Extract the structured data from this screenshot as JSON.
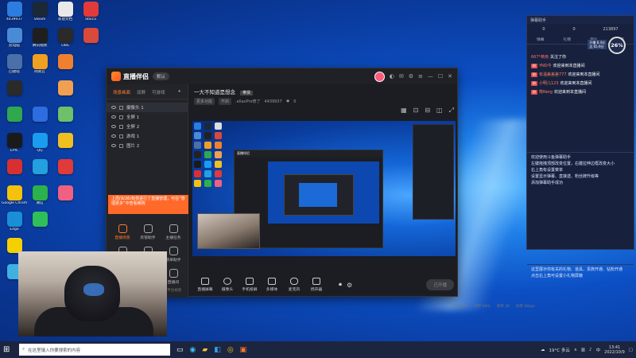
{
  "desktop_icons": [
    {
      "label": "4439937",
      "icon": "pc-icon",
      "color": "#2b7de0"
    },
    {
      "label": "Steam",
      "icon": "steam-icon",
      "color": "#1b2838"
    },
    {
      "label": "新建文档",
      "icon": "doc-icon",
      "color": "#e9e9e9"
    },
    {
      "label": "Stoica",
      "icon": "red-circle-icon",
      "color": "#e23a3a"
    },
    {
      "label": "此电脑",
      "icon": "computer-icon",
      "color": "#4a8bd8"
    },
    {
      "label": "腾讯视频",
      "icon": "video-icon",
      "color": "#1f1f1f"
    },
    {
      "label": "OBS",
      "icon": "obs-icon",
      "color": "#2a2a2a"
    },
    {
      "label": "",
      "icon": "red-icon",
      "color": "#d94a3a"
    },
    {
      "label": "回收站",
      "icon": "bin-icon",
      "color": "#4b6fa8"
    },
    {
      "label": "网易云",
      "icon": "yellow-icon",
      "color": "#f0a020"
    },
    {
      "label": "",
      "icon": "fox-icon",
      "color": "#f08030"
    },
    {
      "label": "",
      "icon": "blank",
      "color": "#00000000"
    },
    {
      "label": "",
      "icon": "dark-icon",
      "color": "#2a2a2a"
    },
    {
      "label": "",
      "icon": "blank",
      "color": "#00000000"
    },
    {
      "label": "",
      "icon": "dog-icon",
      "color": "#f0a050"
    },
    {
      "label": "",
      "icon": "blank",
      "color": "#00000000"
    },
    {
      "label": "",
      "icon": "green-icon",
      "color": "#2fa84f"
    },
    {
      "label": "",
      "icon": "blue-icon",
      "color": "#2d6de0"
    },
    {
      "label": "",
      "icon": "cat-icon",
      "color": "#6fc06a"
    },
    {
      "label": "",
      "icon": "blank",
      "color": "#00000000"
    },
    {
      "label": "EPIC",
      "icon": "epic-icon",
      "color": "#1a1a1a"
    },
    {
      "label": "QQ",
      "icon": "qq-icon",
      "color": "#1a9cf0"
    },
    {
      "label": "",
      "icon": "owl-icon",
      "color": "#f0c020"
    },
    {
      "label": "",
      "icon": "blank",
      "color": "#00000000"
    },
    {
      "label": "",
      "icon": "flash-icon",
      "color": "#d83030"
    },
    {
      "label": "",
      "icon": "circle-icon",
      "color": "#22a0e0"
    },
    {
      "label": "",
      "icon": "red-ball-icon",
      "color": "#e03a3a"
    },
    {
      "label": "",
      "icon": "blank",
      "color": "#00000000"
    },
    {
      "label": "Google Chrome",
      "icon": "chrome-icon",
      "color": "#f4c20d"
    },
    {
      "label": "微信",
      "icon": "wechat-icon",
      "color": "#2bb24c"
    },
    {
      "label": "",
      "icon": "rabbit-icon",
      "color": "#f06080"
    },
    {
      "label": "",
      "icon": "blank",
      "color": "#00000000"
    },
    {
      "label": "Edge",
      "icon": "edge-icon",
      "color": "#1a8fd8"
    },
    {
      "label": "",
      "icon": "ie-icon",
      "color": "#2fbf5a"
    },
    {
      "label": "",
      "icon": "blank",
      "color": "#00000000"
    },
    {
      "label": "",
      "icon": "blank",
      "color": "#00000000"
    },
    {
      "label": "",
      "icon": "norton-icon",
      "color": "#f5d000"
    },
    {
      "label": "",
      "icon": "blank",
      "color": "#00000000"
    },
    {
      "label": "",
      "icon": "blank",
      "color": "#00000000"
    },
    {
      "label": "",
      "icon": "blank",
      "color": "#00000000"
    },
    {
      "label": "",
      "icon": "weibo-icon",
      "color": "#3fb0e0"
    }
  ],
  "window": {
    "app_name": "直播伴侣",
    "version": "默认",
    "left_tabs": [
      "场景画面",
      "双屏",
      "可游戏"
    ],
    "sources": [
      {
        "label": "摄像头 1"
      },
      {
        "label": "全屏 1"
      },
      {
        "label": "全屏 2"
      },
      {
        "label": "游戏 1"
      },
      {
        "label": "图片 2"
      }
    ],
    "notice": "上周(9/26)有你进行了直播管理，可在“管理更多”中查看细则",
    "tools": [
      {
        "label": "直播场景"
      },
      {
        "label": "房管助手"
      },
      {
        "label": "主播任务"
      },
      {
        "label": "抽奖"
      },
      {
        "label": "多人连线"
      },
      {
        "label": "榜单助手"
      },
      {
        "label": ""
      },
      {
        "label": ""
      },
      {
        "label": "直播间"
      }
    ],
    "footer": "开播前请阅读直播规范，遵守直播平台规则",
    "room_title": "一大不知道是想念",
    "room_tag": "带货",
    "room_sub": [
      "更多功能",
      "开启",
      ".ellaoPro修了",
      "4439937",
      "0"
    ],
    "bottom_items": [
      "直播屏幕",
      "摄像头",
      "手机投屏",
      "多媒体",
      "麦克风",
      "扬声器"
    ],
    "go_live": "已开播",
    "status": [
      "CPU 26%",
      "内存 68%",
      "帧率 30",
      "码率 0kbps"
    ]
  },
  "chat": {
    "title": "弹幕助手",
    "stats": [
      "0",
      "0",
      "213897"
    ],
    "tabs": [
      "弹幕",
      "礼物",
      "观众",
      "榜单"
    ],
    "ring_value": "26%",
    "badge": [
      "开播 8.4分",
      "达 65.9分"
    ],
    "messages": [
      {
        "tag": "",
        "name": "667*黄雨",
        "text": "关注了你"
      },
      {
        "tag": "粉",
        "name": "YND今",
        "text": "欢迎来到本直播间"
      },
      {
        "tag": "粉",
        "name": "有温差差差777",
        "text": "欢迎来到本直播间"
      },
      {
        "tag": "粉",
        "name": "小明儿123",
        "text": "欢迎来到本直播间"
      },
      {
        "tag": "粉",
        "name": "熊Nerg",
        "text": "欢迎来到本直播间"
      }
    ],
    "system": "欢迎使用斗鱼弹幕助手\n左键拖拽顶部改变位置，右键拉伸边框改变大小\n右上角有设置菜单\n设置显示弹幕、直接送、粉丝牌升级等\n添加弹幕助手成功",
    "system2": "这里展示你有关的礼物、道具、贵族开通、钻粉开通\n点击右上角可设置小礼物屏蔽"
  },
  "taskbar": {
    "search_placeholder": "在这里输入你要搜索的内容",
    "weather": "19°C 多云",
    "time": "13:41",
    "date": "2022/10/9"
  }
}
